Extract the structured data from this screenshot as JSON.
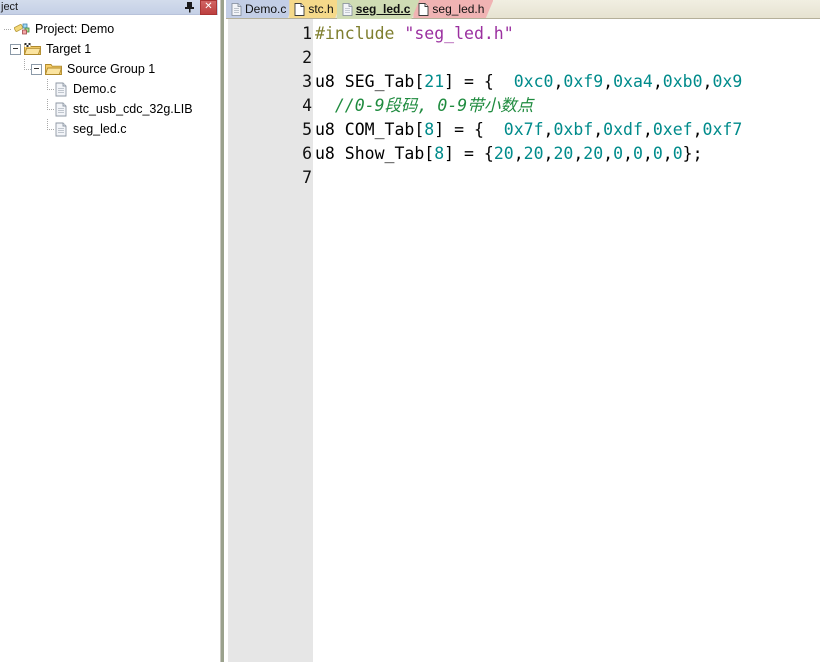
{
  "project_panel": {
    "title": "ject",
    "pin_icon": "pin-icon",
    "close_icon": "close-icon",
    "tree": [
      {
        "id": "project-root",
        "label": "Project: Demo",
        "icon": "project-icon",
        "depth": 0,
        "expander": "none",
        "guide": "none"
      },
      {
        "id": "target-1",
        "label": "Target 1",
        "icon": "target-folder-icon",
        "depth": 1,
        "expander": "minus",
        "guide": "none"
      },
      {
        "id": "source-group-1",
        "label": "Source Group 1",
        "icon": "folder-icon",
        "depth": 2,
        "expander": "minus",
        "guide": "tee"
      },
      {
        "id": "file-demo-c",
        "label": "Demo.c",
        "icon": "file-icon",
        "depth": 3,
        "expander": "none",
        "guide": "tee"
      },
      {
        "id": "file-stc-usb-cdc-32g-lib",
        "label": "stc_usb_cdc_32g.LIB",
        "icon": "file-icon",
        "depth": 3,
        "expander": "none",
        "guide": "tee"
      },
      {
        "id": "file-seg-led-c",
        "label": "seg_led.c",
        "icon": "file-icon",
        "depth": 3,
        "expander": "none",
        "guide": "last"
      }
    ]
  },
  "editor": {
    "tabs": [
      {
        "label": "Demo.c",
        "color_class": "tab-c1",
        "active": false,
        "icon": "document-icon"
      },
      {
        "label": "stc.h",
        "color_class": "tab-c2",
        "active": false,
        "icon": "document-icon"
      },
      {
        "label": "seg_led.c",
        "color_class": "tab-c3",
        "active": true,
        "icon": "document-icon"
      },
      {
        "label": "seg_led.h",
        "color_class": "tab-c4",
        "active": false,
        "icon": "document-icon"
      }
    ],
    "line_numbers": [
      "1",
      "2",
      "3",
      "4",
      "5",
      "6",
      "7"
    ],
    "code_lines": [
      {
        "n": "1",
        "tokens": [
          {
            "t": "#include ",
            "c": "tok-pp"
          },
          {
            "t": "\"seg_led.h\"",
            "c": "tok-str"
          }
        ]
      },
      {
        "n": "2",
        "tokens": [
          {
            "t": "",
            "c": "tok-plain"
          }
        ]
      },
      {
        "n": "3",
        "tokens": [
          {
            "t": "u8 SEG_Tab[",
            "c": "tok-plain"
          },
          {
            "t": "21",
            "c": "tok-num"
          },
          {
            "t": "] = {  ",
            "c": "tok-plain"
          },
          {
            "t": "0xc0",
            "c": "tok-num"
          },
          {
            "t": ",",
            "c": "tok-plain"
          },
          {
            "t": "0xf9",
            "c": "tok-num"
          },
          {
            "t": ",",
            "c": "tok-plain"
          },
          {
            "t": "0xa4",
            "c": "tok-num"
          },
          {
            "t": ",",
            "c": "tok-plain"
          },
          {
            "t": "0xb0",
            "c": "tok-num"
          },
          {
            "t": ",",
            "c": "tok-plain"
          },
          {
            "t": "0x9",
            "c": "tok-num"
          }
        ]
      },
      {
        "n": "4",
        "tokens": [
          {
            "t": "  //0-9段码, 0-9带小数点",
            "c": "tok-cmt"
          }
        ]
      },
      {
        "n": "5",
        "tokens": [
          {
            "t": "u8 COM_Tab[",
            "c": "tok-plain"
          },
          {
            "t": "8",
            "c": "tok-num"
          },
          {
            "t": "] = {  ",
            "c": "tok-plain"
          },
          {
            "t": "0x7f",
            "c": "tok-num"
          },
          {
            "t": ",",
            "c": "tok-plain"
          },
          {
            "t": "0xbf",
            "c": "tok-num"
          },
          {
            "t": ",",
            "c": "tok-plain"
          },
          {
            "t": "0xdf",
            "c": "tok-num"
          },
          {
            "t": ",",
            "c": "tok-plain"
          },
          {
            "t": "0xef",
            "c": "tok-num"
          },
          {
            "t": ",",
            "c": "tok-plain"
          },
          {
            "t": "0xf7",
            "c": "tok-num"
          }
        ]
      },
      {
        "n": "6",
        "tokens": [
          {
            "t": "u8 Show_Tab[",
            "c": "tok-plain"
          },
          {
            "t": "8",
            "c": "tok-num"
          },
          {
            "t": "] = {",
            "c": "tok-plain"
          },
          {
            "t": "20",
            "c": "tok-num"
          },
          {
            "t": ",",
            "c": "tok-plain"
          },
          {
            "t": "20",
            "c": "tok-num"
          },
          {
            "t": ",",
            "c": "tok-plain"
          },
          {
            "t": "20",
            "c": "tok-num"
          },
          {
            "t": ",",
            "c": "tok-plain"
          },
          {
            "t": "20",
            "c": "tok-num"
          },
          {
            "t": ",",
            "c": "tok-plain"
          },
          {
            "t": "0",
            "c": "tok-num"
          },
          {
            "t": ",",
            "c": "tok-plain"
          },
          {
            "t": "0",
            "c": "tok-num"
          },
          {
            "t": ",",
            "c": "tok-plain"
          },
          {
            "t": "0",
            "c": "tok-num"
          },
          {
            "t": ",",
            "c": "tok-plain"
          },
          {
            "t": "0",
            "c": "tok-num"
          },
          {
            "t": "};",
            "c": "tok-plain"
          }
        ]
      },
      {
        "n": "7",
        "tokens": [
          {
            "t": "",
            "c": "tok-plain"
          }
        ]
      }
    ]
  },
  "colors": {
    "preprocessor": "#7f7f2f",
    "string": "#9b30a0",
    "number": "#008b8b",
    "comment": "#1f8b3f",
    "gutter_bg": "#e6e6e6",
    "tab_demo_c": "#c3cee6",
    "tab_stc_h": "#f5d98a",
    "tab_seg_led_c": "#cfdcb4",
    "tab_seg_led_h": "#f0b3b3",
    "panel_title_bg": "#cfd8ea",
    "close_button": "#c94b4b"
  }
}
